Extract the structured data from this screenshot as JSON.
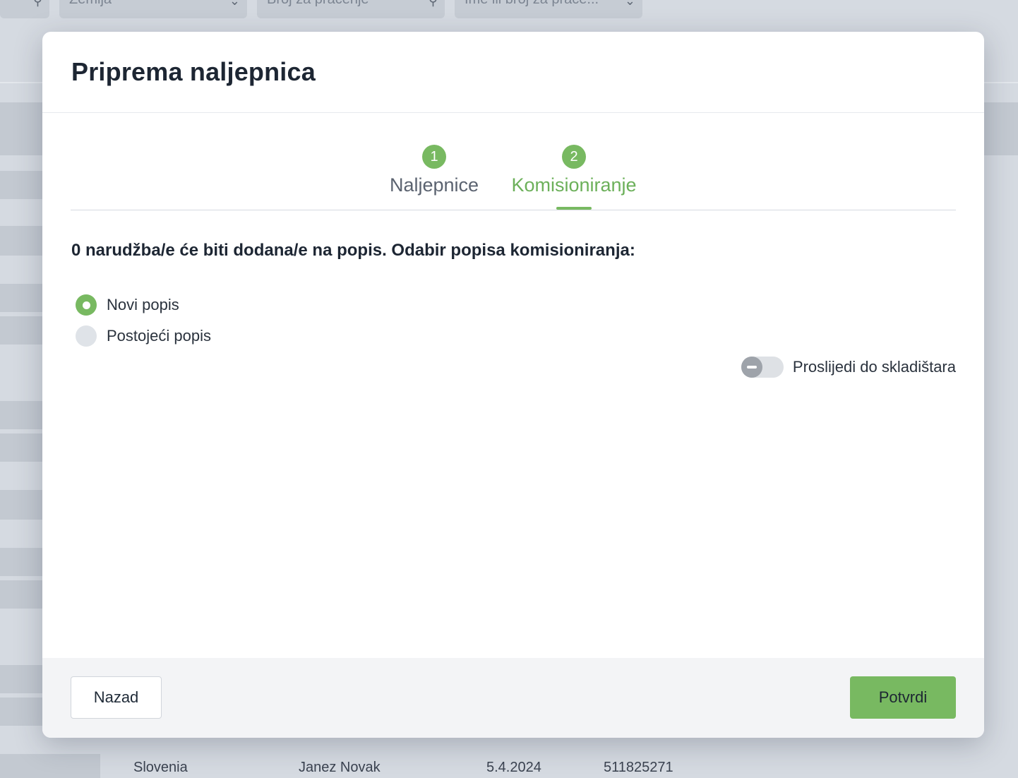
{
  "background": {
    "filters": [
      {
        "label": "Zemlja",
        "icon": "chevron-down-icon"
      },
      {
        "label": "Broj za praćenje",
        "icon": "search-icon"
      },
      {
        "label": "Ime ili broj za praće...",
        "icon": "chevron-down-icon"
      }
    ],
    "row": {
      "country": "Slovenia",
      "name": "Janez Novak",
      "date": "5.4.2024",
      "tracking": "511825271"
    }
  },
  "modal": {
    "title": "Priprema naljepnica",
    "steps": [
      {
        "number": "1",
        "label": "Naljepnice",
        "active": false
      },
      {
        "number": "2",
        "label": "Komisioniranje",
        "active": true
      }
    ],
    "question": "0 narudžba/e će biti dodana/e na popis. Odabir popisa komisioniranja:",
    "options": [
      {
        "label": "Novi popis",
        "selected": true
      },
      {
        "label": "Postojeći popis",
        "selected": false
      }
    ],
    "toggle": {
      "label": "Proslijedi do skladištara",
      "on": false
    },
    "footer": {
      "back_label": "Nazad",
      "confirm_label": "Potvrdi"
    }
  },
  "colors": {
    "accent": "#78b961",
    "overlay": "#d5dae1",
    "title": "#1d2633"
  }
}
